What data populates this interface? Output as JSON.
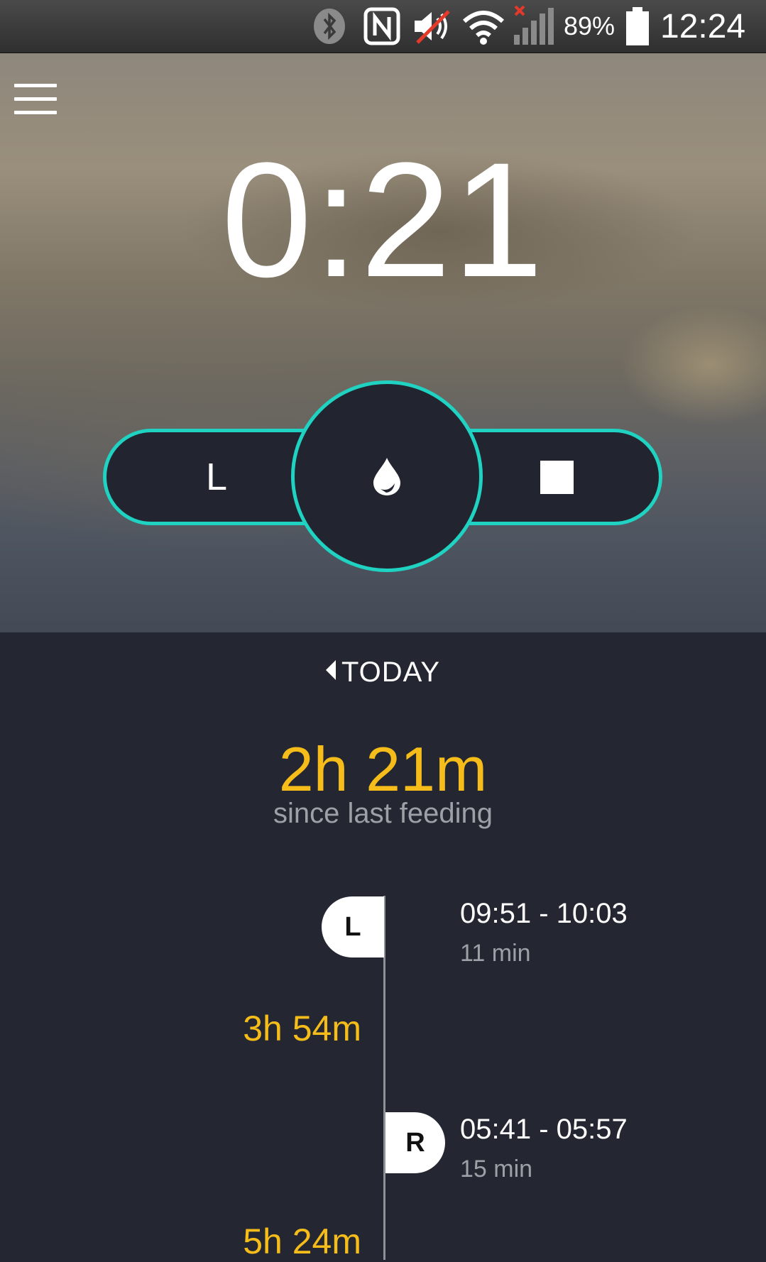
{
  "status_bar": {
    "battery": "89%",
    "time": "12:24",
    "icons": [
      "bluetooth-icon",
      "nfc-icon",
      "mute-icon",
      "wifi-icon",
      "signal-icon",
      "battery-icon"
    ]
  },
  "timer": {
    "value": "0:21"
  },
  "controls": {
    "left_label": "L",
    "center_icon": "drop-icon",
    "right_icon": "stop-icon",
    "accent": "#1fd2c1"
  },
  "day_nav": {
    "label": "TODAY"
  },
  "summary": {
    "value": "2h 21m",
    "label": "since last feeding",
    "accent": "#f6bd1a"
  },
  "timeline": {
    "entries": [
      {
        "side": "L",
        "time": "09:51 - 10:03",
        "duration": "11 min"
      },
      {
        "side": "R",
        "time": "05:41 - 05:57",
        "duration": "15 min"
      }
    ],
    "gaps": [
      "3h 54m",
      "5h 24m"
    ]
  }
}
